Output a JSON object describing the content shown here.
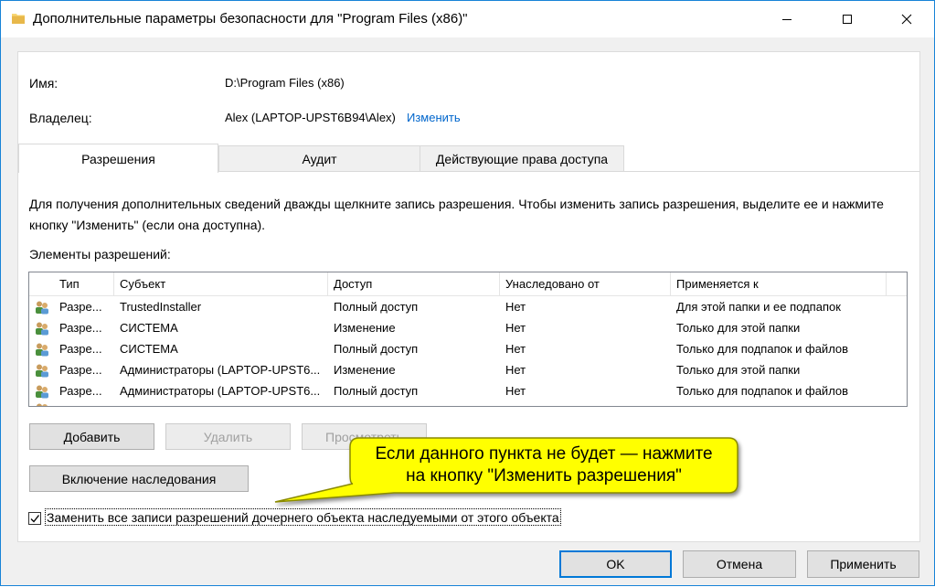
{
  "window": {
    "title": "Дополнительные параметры безопасности  для \"Program Files (x86)\""
  },
  "fields": {
    "name_label": "Имя:",
    "name_value": "D:\\Program Files (x86)",
    "owner_label": "Владелец:",
    "owner_value": "Alex (LAPTOP-UPST6B94\\Alex)",
    "owner_change_link": "Изменить"
  },
  "tabs": [
    {
      "label": "Разрешения",
      "active": true
    },
    {
      "label": "Аудит",
      "active": false
    },
    {
      "label": "Действующие права доступа",
      "active": false
    }
  ],
  "description": "Для получения дополнительных сведений дважды щелкните запись разрешения. Чтобы изменить запись разрешения, выделите ее и нажмите кнопку \"Изменить\" (если она доступна).",
  "permissions_label": "Элементы разрешений:",
  "table": {
    "columns": [
      "Тип",
      "Субъект",
      "Доступ",
      "Унаследовано от",
      "Применяется к"
    ],
    "rows": [
      {
        "icon": "users-icon",
        "type": "Разре...",
        "subject": "TrustedInstaller",
        "access": "Полный доступ",
        "inherited": "Нет",
        "applies": "Для этой папки и ее подпапок"
      },
      {
        "icon": "users-icon",
        "type": "Разре...",
        "subject": "СИСТЕМА",
        "access": "Изменение",
        "inherited": "Нет",
        "applies": "Только для этой папки"
      },
      {
        "icon": "users-icon",
        "type": "Разре...",
        "subject": "СИСТЕМА",
        "access": "Полный доступ",
        "inherited": "Нет",
        "applies": "Только для подпапок и файлов"
      },
      {
        "icon": "users-icon",
        "type": "Разре...",
        "subject": "Администраторы (LAPTOP-UPST6...",
        "access": "Изменение",
        "inherited": "Нет",
        "applies": "Только для этой папки"
      },
      {
        "icon": "users-icon",
        "type": "Разре...",
        "subject": "Администраторы (LAPTOP-UPST6...",
        "access": "Полный доступ",
        "inherited": "Нет",
        "applies": "Только для подпапок и файлов"
      }
    ]
  },
  "buttons": {
    "add": "Добавить",
    "remove": "Удалить",
    "view": "Просмотреть",
    "enable_inheritance": "Включение наследования",
    "ok": "OK",
    "cancel": "Отмена",
    "apply": "Применить"
  },
  "checkbox": {
    "label": "Заменить все записи разрешений дочернего объекта наследуемыми от этого объекта",
    "checked": true
  },
  "callout": {
    "line1": "Если данного пункта не будет — нажмите",
    "line2": "на кнопку \"Изменить разрешения\"",
    "fill": "#ffff00",
    "border": "#8a8a00"
  }
}
